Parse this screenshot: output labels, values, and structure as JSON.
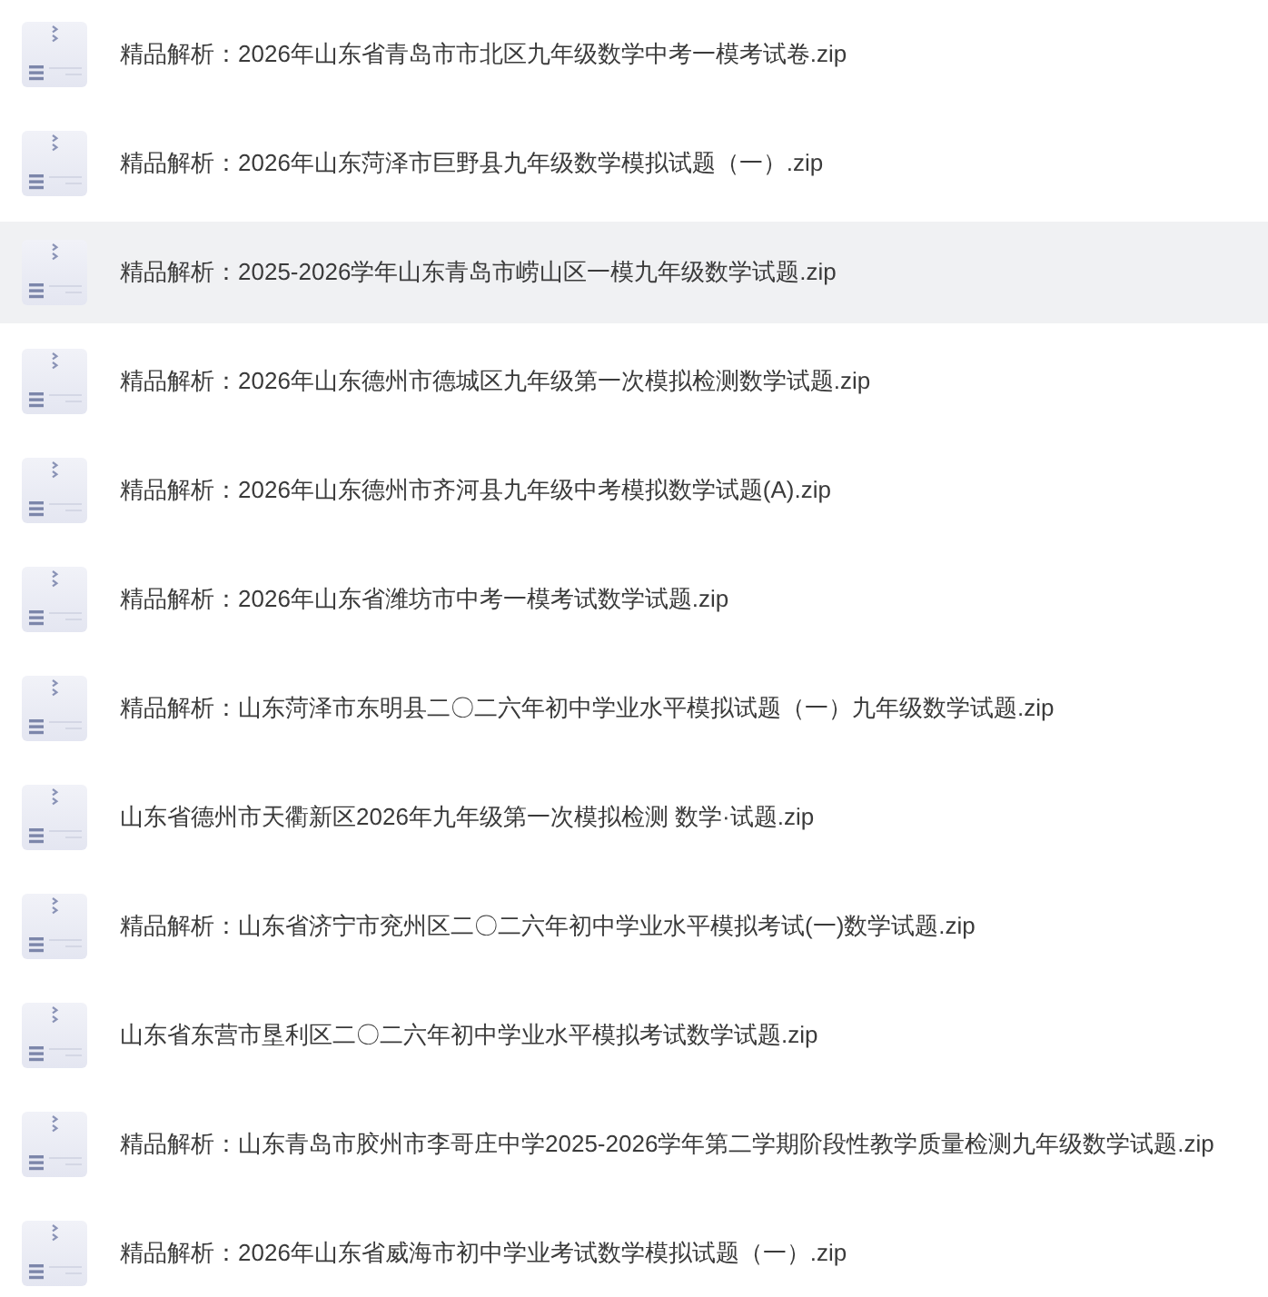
{
  "files": [
    {
      "name": "精品解析：2026年山东省青岛市市北区九年级数学中考一模考试卷.zip",
      "selected": false
    },
    {
      "name": "精品解析：2026年山东菏泽市巨野县九年级数学模拟试题（一）.zip",
      "selected": false
    },
    {
      "name": "精品解析：2025-2026学年山东青岛市崂山区一模九年级数学试题.zip",
      "selected": true
    },
    {
      "name": "精品解析：2026年山东德州市德城区九年级第一次模拟检测数学试题.zip",
      "selected": false
    },
    {
      "name": "精品解析：2026年山东德州市齐河县九年级中考模拟数学试题(A).zip",
      "selected": false
    },
    {
      "name": "精品解析：2026年山东省潍坊市中考一模考试数学试题.zip",
      "selected": false
    },
    {
      "name": "精品解析：山东菏泽市东明县二〇二六年初中学业水平模拟试题（一）九年级数学试题.zip",
      "selected": false
    },
    {
      "name": "山东省德州市天衢新区2026年九年级第一次模拟检测 数学·试题.zip",
      "selected": false
    },
    {
      "name": "精品解析：山东省济宁市兖州区二〇二六年初中学业水平模拟考试(一)数学试题.zip",
      "selected": false
    },
    {
      "name": "山东省东营市垦利区二〇二六年初中学业水平模拟考试数学试题.zip",
      "selected": false
    },
    {
      "name": "精品解析：山东青岛市胶州市李哥庄中学2025-2026学年第二学期阶段性教学质量检测九年级数学试题.zip",
      "selected": false
    },
    {
      "name": "精品解析：2026年山东省威海市初中学业考试数学模拟试题（一）.zip",
      "selected": false
    }
  ]
}
